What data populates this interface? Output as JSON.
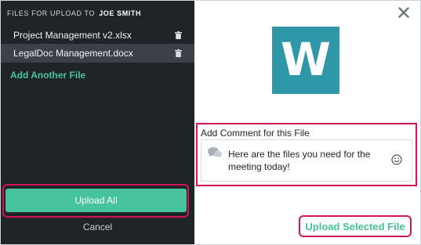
{
  "sidebar": {
    "header_prefix": "FILES FOR UPLOAD TO",
    "header_name": "JOE SMITH",
    "files": [
      {
        "name": "Project Management v2.xlsx"
      },
      {
        "name": "LegalDoc Management.docx"
      }
    ],
    "add_file_label": "Add Another File",
    "upload_all_label": "Upload All",
    "cancel_label": "Cancel"
  },
  "preview": {
    "logo_letter": "W",
    "logo_color": "#2f97a8",
    "close_icon": "close-icon"
  },
  "comment": {
    "label": "Add Comment for this File",
    "value": "Here are the files you need for the meeting today!"
  },
  "actions": {
    "upload_selected_label": "Upload Selected File"
  },
  "colors": {
    "accent": "#46c39b",
    "highlight": "#d4145a",
    "sidebar_bg": "#1f2428"
  }
}
